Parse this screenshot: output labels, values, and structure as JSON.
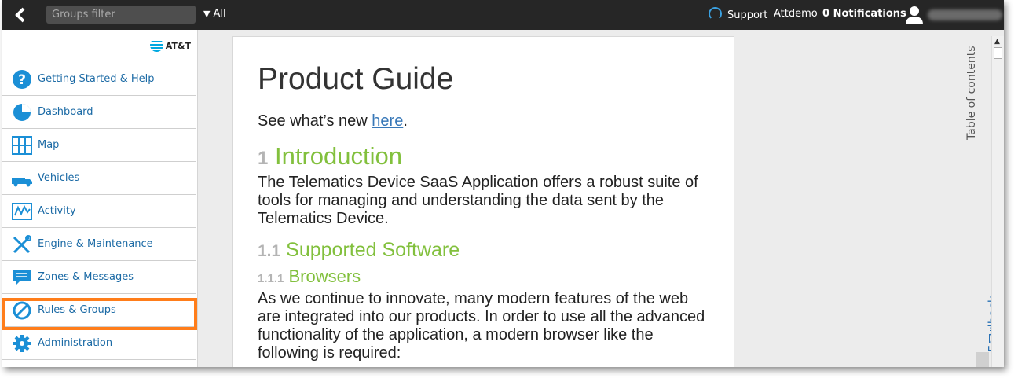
{
  "topbar": {
    "search_placeholder": "Groups filter",
    "groups_label": "All",
    "support_label": "Support",
    "user_label": "Attdemo",
    "notifications_label": "0 Notifications"
  },
  "sidebar": {
    "brand": "AT&T",
    "items": [
      {
        "label": "Getting Started & Help",
        "icon": "help-icon"
      },
      {
        "label": "Dashboard",
        "icon": "pie-chart-icon"
      },
      {
        "label": "Map",
        "icon": "map-icon"
      },
      {
        "label": "Vehicles",
        "icon": "truck-icon"
      },
      {
        "label": "Activity",
        "icon": "activity-icon"
      },
      {
        "label": "Engine & Maintenance",
        "icon": "wrench-icon"
      },
      {
        "label": "Zones & Messages",
        "icon": "message-icon"
      },
      {
        "label": "Rules & Groups",
        "icon": "no-entry-icon"
      },
      {
        "label": "Administration",
        "icon": "gear-icon"
      }
    ],
    "highlighted_item": "Rules & Groups"
  },
  "document": {
    "title": "Product Guide",
    "whats_new_prefix": "See what’s new ",
    "whats_new_link": "here",
    "whats_new_suffix": ".",
    "section1_num": "1",
    "section1_title": "Introduction",
    "section1_text": "The Telematics Device SaaS Application offers a robust suite of tools for managing and understanding the data sent by the Telematics Device.",
    "section11_num": "1.1",
    "section11_title": "Supported Software",
    "section111_num": "1.1.1",
    "section111_title": "Browsers",
    "section111_text": "As we continue to innovate, many modern features of the web are integrated into our products. In order to use all the advanced functionality of the application, a modern browser like the following is required:"
  },
  "right_rail": {
    "toc_label": "Table of contents",
    "feedback_label": "Feedback"
  },
  "colors": {
    "topbar": "#262626",
    "link": "#1b6aa5",
    "heading_green": "#82c03d",
    "highlight": "#ff7d1a"
  }
}
